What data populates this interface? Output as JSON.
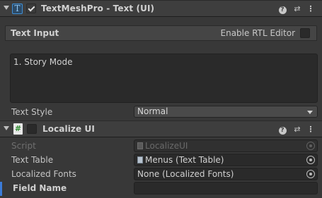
{
  "textmeshpro": {
    "title": "TextMeshPro - Text (UI)",
    "icon_letter": "T",
    "enabled": true,
    "text_input_header": "Text Input",
    "rtl_label": "Enable RTL Editor",
    "rtl_enabled": false,
    "text_value": "1. Story Mode",
    "text_style_label": "Text Style",
    "text_style_value": "Normal"
  },
  "localize": {
    "title": "Localize UI",
    "icon_glyph": "#",
    "enabled": false,
    "rows": [
      {
        "label": "Script",
        "value": "LocalizeUI"
      },
      {
        "label": "Text Table",
        "value": "Menus (Text Table)"
      },
      {
        "label": "Localized Fonts",
        "value": "None (Localized Fonts)"
      },
      {
        "label": "Field Name",
        "value": ""
      }
    ]
  },
  "header_icons": {
    "help": "?",
    "settings": "⇄",
    "menu": "⋮"
  },
  "colors": {
    "tmp_icon": "#3f8fd6",
    "localize_icon": "#5cb85c",
    "accent_bar": "#3b7bd8"
  }
}
